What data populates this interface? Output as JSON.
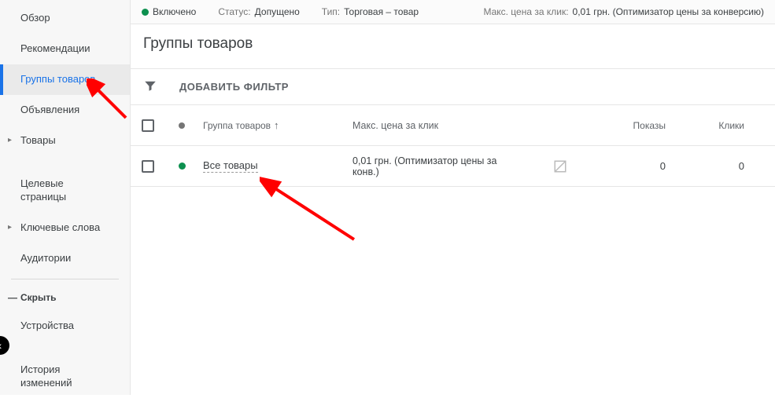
{
  "sidebar": {
    "items": [
      {
        "label": "Обзор"
      },
      {
        "label": "Рекомендации"
      },
      {
        "label": "Группы товаров"
      },
      {
        "label": "Объявления"
      },
      {
        "label": "Товары"
      },
      {
        "label": "Целевые\nстраницы"
      },
      {
        "label": "Ключевые слова"
      },
      {
        "label": "Аудитории"
      }
    ],
    "hide_label": "Скрыть",
    "footer_items": [
      {
        "label": "Устройства"
      },
      {
        "label": "История\nизменений"
      }
    ]
  },
  "top": {
    "enabled": "Включено",
    "status_label": "Статус:",
    "status_value": "Допущено",
    "type_label": "Тип:",
    "type_value": "Торговая – товар",
    "cpc_label": "Макс. цена за клик:",
    "cpc_value": "0,01 грн. (Оптимизатор цены за конверсию)"
  },
  "page_title": "Группы товаров",
  "filter_label": "ДОБАВИТЬ ФИЛЬТР",
  "table": {
    "headers": {
      "group": "Группа товаров",
      "cpc": "Макс. цена за клик",
      "shows": "Показы",
      "clicks": "Клики"
    },
    "rows": [
      {
        "group": "Все товары",
        "cpc": "0,01 грн. (Оптимизатор цены за конв.)",
        "shows": "0",
        "clicks": "0"
      }
    ]
  }
}
